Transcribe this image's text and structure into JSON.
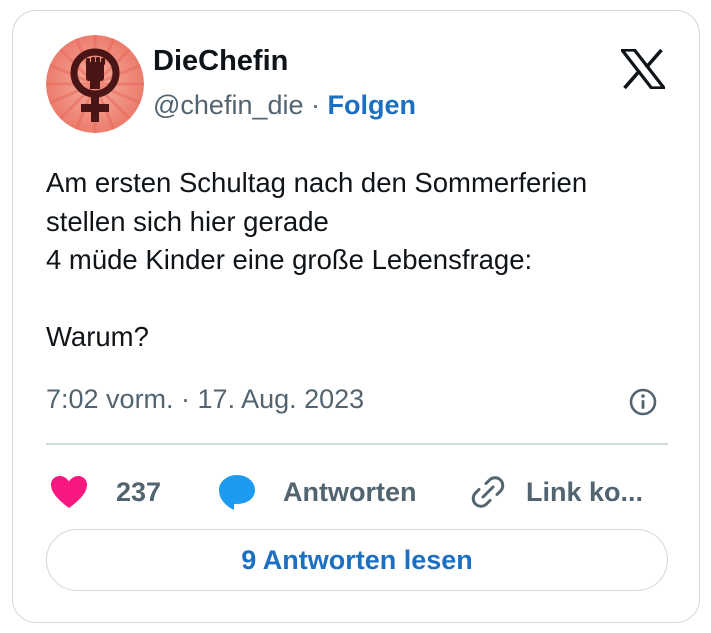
{
  "author": {
    "display_name": "DieChefin",
    "handle": "@chefin_die",
    "separator": "·",
    "follow_label": "Folgen",
    "avatar_icon": "feminist-fist-symbol-icon"
  },
  "brand": {
    "logo_icon": "x-logo-icon"
  },
  "tweet": {
    "lines": [
      "Am ersten Schultag nach den Sommerferien",
      "stellen sich hier gerade",
      "4 müde Kinder eine große Lebensfrage:",
      "",
      "Warum?"
    ],
    "timestamp": "7:02 vorm. · 17. Aug. 2023",
    "info_icon": "info-icon"
  },
  "actions": {
    "like_count": "237",
    "like_icon": "heart-icon",
    "reply_label": "Antworten",
    "reply_icon": "speech-bubble-icon",
    "copy_label": "Link ko...",
    "copy_icon": "link-icon"
  },
  "read_replies_label": "9 Antworten lesen",
  "colors": {
    "accent": "#1d6fc2",
    "like": "#f91880",
    "reply": "#1d9bf0",
    "avatar_bg": "#f08878",
    "avatar_symbol": "#5a1a1a",
    "text_primary": "#0f1419",
    "text_secondary": "#536471",
    "border": "#cfd9de"
  }
}
